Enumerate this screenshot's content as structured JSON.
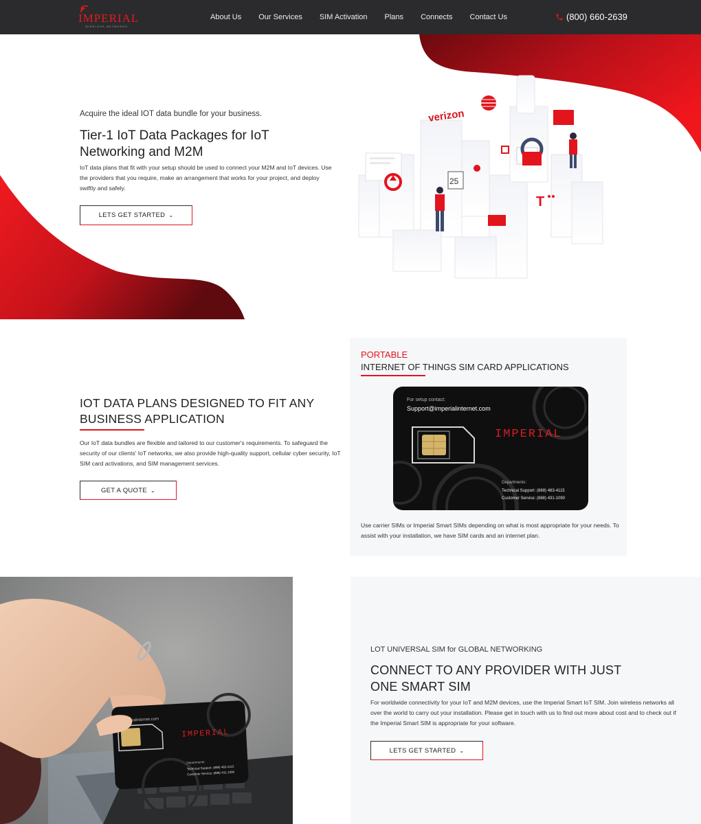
{
  "nav": {
    "brand": "IMPERIAL",
    "brand_sub": "WIRELESS NETWORKS",
    "items": [
      "About Us",
      "Our Services",
      "SIM Activation",
      "Plans",
      "Connects",
      "Contact Us"
    ],
    "phone": "(800) 660-2639"
  },
  "hero": {
    "kicker": "Acquire the ideal IOT data bundle for your business.",
    "title": "Tier-1 IoT Data Packages for IoT Networking and M2M",
    "text": "IoT data plans that fit with your setup should be used to connect your M2M and IoT devices. Use the providers that you require, make an arrangement that works for your project, and deploy swiftly and safely.",
    "button": "LETS GET STARTED",
    "illustration_labels": {
      "verizon": "verizon",
      "date": "25",
      "tmobile": "T"
    }
  },
  "plans": {
    "title": "IOT DATA PLANS DESIGNED TO FIT ANY BUSINESS APPLICATION",
    "text": "Our IoT data bundles are flexible and tailored to our customer's requirements. To safeguard the security of our clients' IoT networks, we also provide high-quality support, cellular cyber security, IoT SIM card activations, and SIM management services.",
    "button": "GET A QUOTE"
  },
  "portable": {
    "kicker": "PORTABLE",
    "title": "INTERNET OF THINGS SIM CARD APPLICATIONS",
    "card": {
      "setup_label": "For setup contact:",
      "email": "Support@imperialinternet.com",
      "brand": "IMPERIAL",
      "departments": "Departments:",
      "technical": "Technical Support: (888) 483-4115",
      "customer": "Customer Service: (888) 431-1090"
    },
    "text": "Use carrier SIMs or Imperial Smart SIMs depending on what is most appropriate for your needs. To assist with your installation, we have SIM cards and an internet plan."
  },
  "universal": {
    "kicker": "LOT UNIVERSAL SIM for GLOBAL NETWORKING",
    "title": "CONNECT TO ANY PROVIDER WITH JUST ONE SMART SIM",
    "text": "For worldwide connectivity for your IoT and M2M devices, use the Imperial Smart IoT SIM. Join wireless networks all over the world to carry out your installation. Please get in touch with us to find out more about cost and to check out if the Imperial Smart SIM is appropriate for your software.",
    "button": "LETS GET STARTED",
    "photo_card": {
      "email": "imperialinternet.com",
      "brand": "IMPERIAL",
      "departments": "Departments:",
      "technical": "Technical Support: (888) 483-4115",
      "customer": "Customer Service: (888) 431-1090"
    }
  },
  "colors": {
    "accent": "#e2141c",
    "nav_bg": "#2b2b2d",
    "panel_bg": "#f6f7f9"
  },
  "icons": [
    "wifi-icon",
    "phone-icon",
    "chevron-down-icon"
  ]
}
